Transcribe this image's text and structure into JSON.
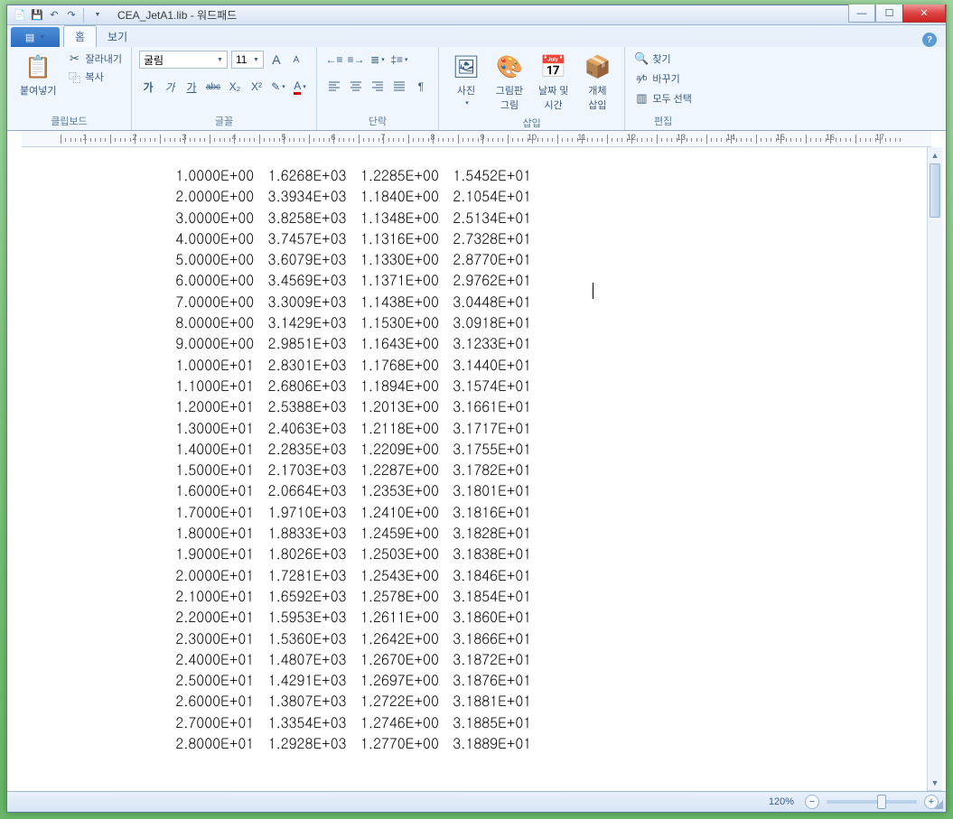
{
  "title": {
    "filename": "CEA_JetA1.lib",
    "app": "워드패드"
  },
  "tabs": {
    "home": "홈",
    "view": "보기"
  },
  "clipboard": {
    "paste": "붙여넣기",
    "cut": "잘라내기",
    "copy": "복사",
    "group_label": "클립보드"
  },
  "font": {
    "name": "굴림",
    "size": "11",
    "grow": "A",
    "shrink": "A",
    "bold": "가",
    "italic": "가",
    "underline": "가",
    "strike": "abc",
    "subscript": "X₂",
    "superscript": "X²",
    "highlight": "✎",
    "color": "A",
    "group_label": "글꼴"
  },
  "paragraph": {
    "group_label": "단락"
  },
  "insert": {
    "picture": "사진",
    "paint": "그림판\n그림",
    "datetime": "날짜 및\n시간",
    "object": "개체\n삽입",
    "group_label": "삽입"
  },
  "editing": {
    "find": "찾기",
    "replace": "바꾸기",
    "selectall": "모두 선택",
    "group_label": "편집"
  },
  "status": {
    "zoom": "120%"
  },
  "ruler_numbers": [
    "1",
    "2",
    "3",
    "4",
    "5",
    "6",
    "7",
    "8",
    "9",
    "10",
    "11",
    "12",
    "13",
    "14",
    "15",
    "16",
    "17"
  ],
  "rows": [
    [
      "1.0000E+00",
      "1.6268E+03",
      "1.2285E+00",
      "1.5452E+01"
    ],
    [
      "2.0000E+00",
      "3.3934E+03",
      "1.1840E+00",
      "2.1054E+01"
    ],
    [
      "3.0000E+00",
      "3.8258E+03",
      "1.1348E+00",
      "2.5134E+01"
    ],
    [
      "4.0000E+00",
      "3.7457E+03",
      "1.1316E+00",
      "2.7328E+01"
    ],
    [
      "5.0000E+00",
      "3.6079E+03",
      "1.1330E+00",
      "2.8770E+01"
    ],
    [
      "6.0000E+00",
      "3.4569E+03",
      "1.1371E+00",
      "2.9762E+01"
    ],
    [
      "7.0000E+00",
      "3.3009E+03",
      "1.1438E+00",
      "3.0448E+01"
    ],
    [
      "8.0000E+00",
      "3.1429E+03",
      "1.1530E+00",
      "3.0918E+01"
    ],
    [
      "9.0000E+00",
      "2.9851E+03",
      "1.1643E+00",
      "3.1233E+01"
    ],
    [
      "1.0000E+01",
      "2.8301E+03",
      "1.1768E+00",
      "3.1440E+01"
    ],
    [
      "1.1000E+01",
      "2.6806E+03",
      "1.1894E+00",
      "3.1574E+01"
    ],
    [
      "1.2000E+01",
      "2.5388E+03",
      "1.2013E+00",
      "3.1661E+01"
    ],
    [
      "1.3000E+01",
      "2.4063E+03",
      "1.2118E+00",
      "3.1717E+01"
    ],
    [
      "1.4000E+01",
      "2.2835E+03",
      "1.2209E+00",
      "3.1755E+01"
    ],
    [
      "1.5000E+01",
      "2.1703E+03",
      "1.2287E+00",
      "3.1782E+01"
    ],
    [
      "1.6000E+01",
      "2.0664E+03",
      "1.2353E+00",
      "3.1801E+01"
    ],
    [
      "1.7000E+01",
      "1.9710E+03",
      "1.2410E+00",
      "3.1816E+01"
    ],
    [
      "1.8000E+01",
      "1.8833E+03",
      "1.2459E+00",
      "3.1828E+01"
    ],
    [
      "1.9000E+01",
      "1.8026E+03",
      "1.2503E+00",
      "3.1838E+01"
    ],
    [
      "2.0000E+01",
      "1.7281E+03",
      "1.2543E+00",
      "3.1846E+01"
    ],
    [
      "2.1000E+01",
      "1.6592E+03",
      "1.2578E+00",
      "3.1854E+01"
    ],
    [
      "2.2000E+01",
      "1.5953E+03",
      "1.2611E+00",
      "3.1860E+01"
    ],
    [
      "2.3000E+01",
      "1.5360E+03",
      "1.2642E+00",
      "3.1866E+01"
    ],
    [
      "2.4000E+01",
      "1.4807E+03",
      "1.2670E+00",
      "3.1872E+01"
    ],
    [
      "2.5000E+01",
      "1.4291E+03",
      "1.2697E+00",
      "3.1876E+01"
    ],
    [
      "2.6000E+01",
      "1.3807E+03",
      "1.2722E+00",
      "3.1881E+01"
    ],
    [
      "2.7000E+01",
      "1.3354E+03",
      "1.2746E+00",
      "3.1885E+01"
    ],
    [
      "2.8000E+01",
      "1.2928E+03",
      "1.2770E+00",
      "3.1889E+01"
    ]
  ]
}
